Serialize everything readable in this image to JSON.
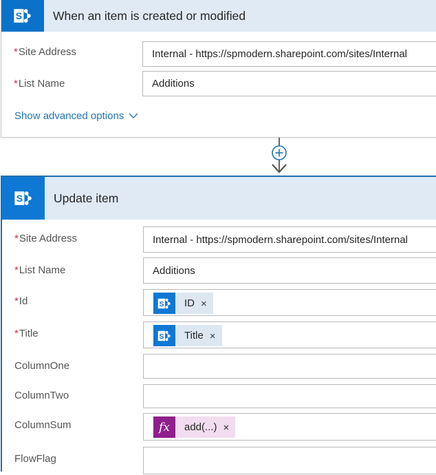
{
  "trigger": {
    "title": "When an item is created or modified",
    "fields": {
      "site_address": {
        "label": "Site Address",
        "value": "Internal - https://spmodern.sharepoint.com/sites/Internal"
      },
      "list_name": {
        "label": "List Name",
        "value": "Additions"
      }
    },
    "advanced_link": "Show advanced options"
  },
  "action": {
    "title": "Update item",
    "fields": {
      "site_address": {
        "label": "Site Address",
        "value": "Internal - https://spmodern.sharepoint.com/sites/Internal"
      },
      "list_name": {
        "label": "List Name",
        "value": "Additions"
      },
      "id": {
        "label": "Id",
        "token": "ID"
      },
      "title": {
        "label": "Title",
        "token": "Title"
      },
      "column_one": {
        "label": "ColumnOne",
        "value": ""
      },
      "column_two": {
        "label": "ColumnTwo",
        "value": ""
      },
      "column_sum": {
        "label": "ColumnSum",
        "token": "add(...)"
      },
      "flow_flag": {
        "label": "FlowFlag",
        "value": ""
      }
    }
  },
  "required_marker": "*",
  "token_remove": "×",
  "icons": {
    "sharepoint": "sharepoint-icon",
    "expression": "fx-icon",
    "add_step": "plus-circle-icon",
    "chevron": "chevron-down-icon"
  },
  "colors": {
    "header_bg": "#dfeaf5",
    "sharepoint_blue": "#0f78d4",
    "active_border": "#1f6fb3",
    "link": "#1e75b8",
    "required": "#c4314b",
    "expression": "#8f1f8b",
    "expression_token_bg": "#f2dcef",
    "dynamic_token_bg": "#dde7f1"
  }
}
